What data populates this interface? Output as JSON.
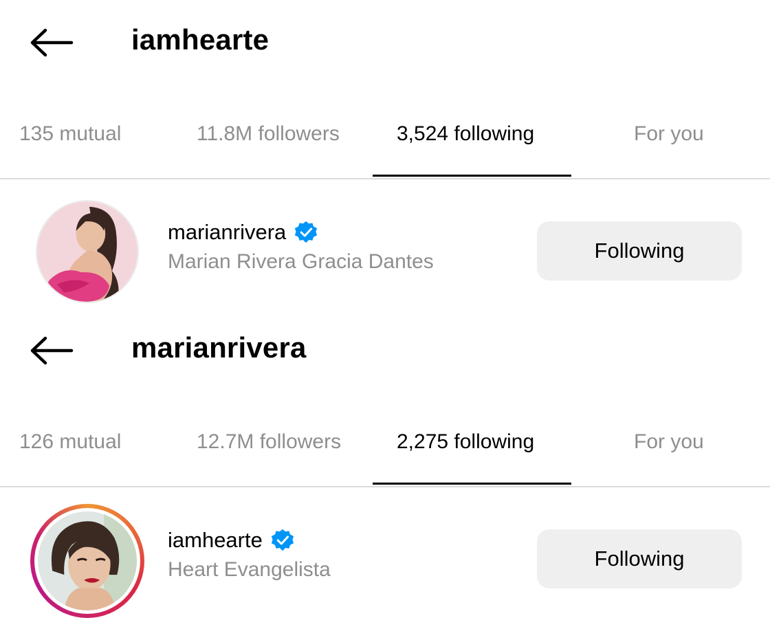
{
  "panels": [
    {
      "title": "iamhearte",
      "tabs": [
        "135 mutual",
        "11.8M followers",
        "3,524 following",
        "For you"
      ],
      "active_tab": "3,524 following",
      "user": {
        "username": "marianrivera",
        "full_name": "Marian Rivera Gracia Dantes",
        "verified": true,
        "button_label": "Following"
      }
    },
    {
      "title": "marianrivera",
      "tabs": [
        "126 mutual",
        "12.7M followers",
        "2,275 following",
        "For you"
      ],
      "active_tab": "2,275 following",
      "user": {
        "username": "iamhearte",
        "full_name": "Heart Evangelista",
        "verified": true,
        "button_label": "Following"
      }
    }
  ],
  "icons": {
    "back": "arrow-left-icon",
    "verified": "verified-badge-icon"
  },
  "colors": {
    "verified_blue": "#0095f6",
    "muted_text": "#8e8e8e",
    "button_bg": "#efefef",
    "divider": "#dbdbdb"
  }
}
